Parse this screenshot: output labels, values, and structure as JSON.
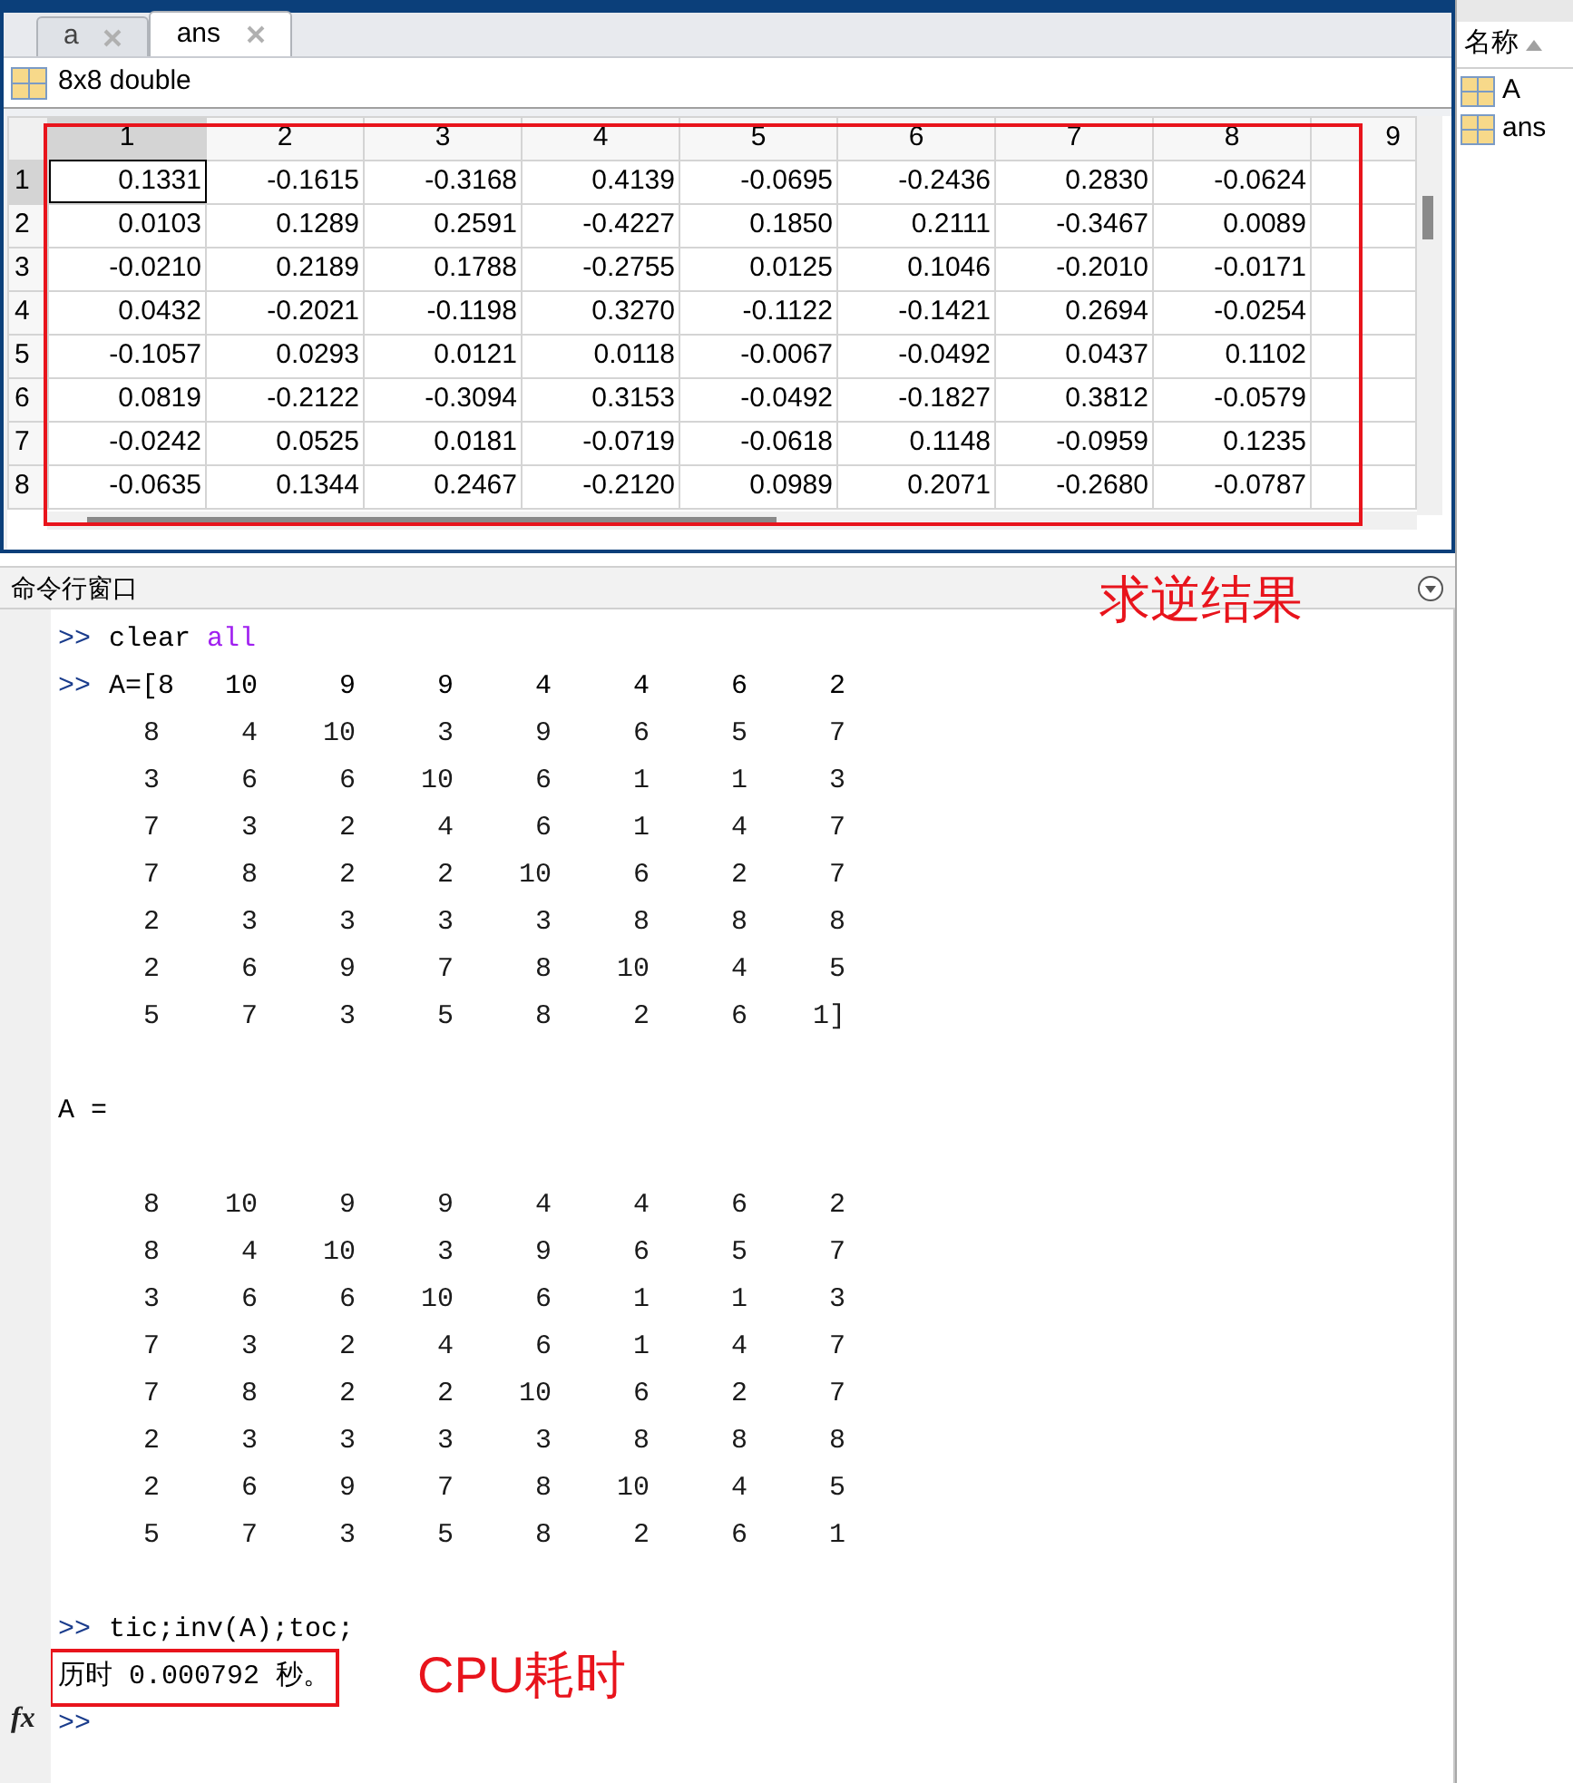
{
  "variable_editor": {
    "tabs": [
      {
        "label": "a",
        "selected": false
      },
      {
        "label": "ans",
        "selected": true
      }
    ],
    "variable_info": "8x8 double",
    "table": {
      "highlighted": true,
      "columns": [
        "1",
        "2",
        "3",
        "4",
        "5",
        "6",
        "7",
        "8",
        "9"
      ],
      "rows": [
        {
          "header": "1",
          "cells": [
            "0.1331",
            "-0.1615",
            "-0.3168",
            "0.4139",
            "-0.0695",
            "-0.2436",
            "0.2830",
            "-0.0624"
          ]
        },
        {
          "header": "2",
          "cells": [
            "0.0103",
            "0.1289",
            "0.2591",
            "-0.4227",
            "0.1850",
            "0.2111",
            "-0.3467",
            "0.0089"
          ]
        },
        {
          "header": "3",
          "cells": [
            "-0.0210",
            "0.2189",
            "0.1788",
            "-0.2755",
            "0.0125",
            "0.1046",
            "-0.2010",
            "-0.0171"
          ]
        },
        {
          "header": "4",
          "cells": [
            "0.0432",
            "-0.2021",
            "-0.1198",
            "0.3270",
            "-0.1122",
            "-0.1421",
            "0.2694",
            "-0.0254"
          ]
        },
        {
          "header": "5",
          "cells": [
            "-0.1057",
            "0.0293",
            "0.0121",
            "0.0118",
            "-0.0067",
            "-0.0492",
            "0.0437",
            "0.1102"
          ]
        },
        {
          "header": "6",
          "cells": [
            "0.0819",
            "-0.2122",
            "-0.3094",
            "0.3153",
            "-0.0492",
            "-0.1827",
            "0.3812",
            "-0.0579"
          ]
        },
        {
          "header": "7",
          "cells": [
            "-0.0242",
            "0.0525",
            "0.0181",
            "-0.0719",
            "-0.0618",
            "0.1148",
            "-0.0959",
            "0.1235"
          ]
        },
        {
          "header": "8",
          "cells": [
            "-0.0635",
            "0.1344",
            "0.2467",
            "-0.2120",
            "0.0989",
            "0.2071",
            "-0.2680",
            "-0.0787"
          ]
        }
      ]
    }
  },
  "workspace": {
    "column_header": "名称",
    "items": [
      "A",
      "ans"
    ]
  },
  "command_window": {
    "title": "命令行窗口",
    "lines": [
      {
        "kind": "input",
        "prompt": ">>",
        "text": "clear",
        "keyword": "all"
      },
      {
        "kind": "matrix",
        "prompt": ">>",
        "lead": "A=[",
        "rows": [
          [
            "8",
            "10",
            "9",
            "9",
            "4",
            "4",
            "6",
            "2"
          ],
          [
            "8",
            "4",
            "10",
            "3",
            "9",
            "6",
            "5",
            "7"
          ],
          [
            "3",
            "6",
            "6",
            "10",
            "6",
            "1",
            "1",
            "3"
          ],
          [
            "7",
            "3",
            "2",
            "4",
            "6",
            "1",
            "4",
            "7"
          ],
          [
            "7",
            "8",
            "2",
            "2",
            "10",
            "6",
            "2",
            "7"
          ],
          [
            "2",
            "3",
            "3",
            "3",
            "3",
            "8",
            "8",
            "8"
          ],
          [
            "2",
            "6",
            "9",
            "7",
            "8",
            "10",
            "4",
            "5"
          ],
          [
            "5",
            "7",
            "3",
            "5",
            "8",
            "2",
            "6",
            "1]"
          ]
        ]
      },
      {
        "kind": "blank"
      },
      {
        "kind": "output",
        "text": "A ="
      },
      {
        "kind": "blank"
      },
      {
        "kind": "matrix",
        "rows": [
          [
            "8",
            "10",
            "9",
            "9",
            "4",
            "4",
            "6",
            "2"
          ],
          [
            "8",
            "4",
            "10",
            "3",
            "9",
            "6",
            "5",
            "7"
          ],
          [
            "3",
            "6",
            "6",
            "10",
            "6",
            "1",
            "1",
            "3"
          ],
          [
            "7",
            "3",
            "2",
            "4",
            "6",
            "1",
            "4",
            "7"
          ],
          [
            "7",
            "8",
            "2",
            "2",
            "10",
            "6",
            "2",
            "7"
          ],
          [
            "2",
            "3",
            "3",
            "3",
            "3",
            "8",
            "8",
            "8"
          ],
          [
            "2",
            "6",
            "9",
            "7",
            "8",
            "10",
            "4",
            "5"
          ],
          [
            "5",
            "7",
            "3",
            "5",
            "8",
            "2",
            "6",
            "1"
          ]
        ]
      },
      {
        "kind": "blank"
      },
      {
        "kind": "input",
        "prompt": ">>",
        "text": "tic;inv(A);toc;"
      },
      {
        "kind": "output",
        "text": "历时 0.000792 秒。",
        "highlighted": true
      }
    ],
    "current_prompt": ">>",
    "function_button": "fx"
  },
  "annotations": [
    "求逆结果",
    "CPU耗时"
  ]
}
